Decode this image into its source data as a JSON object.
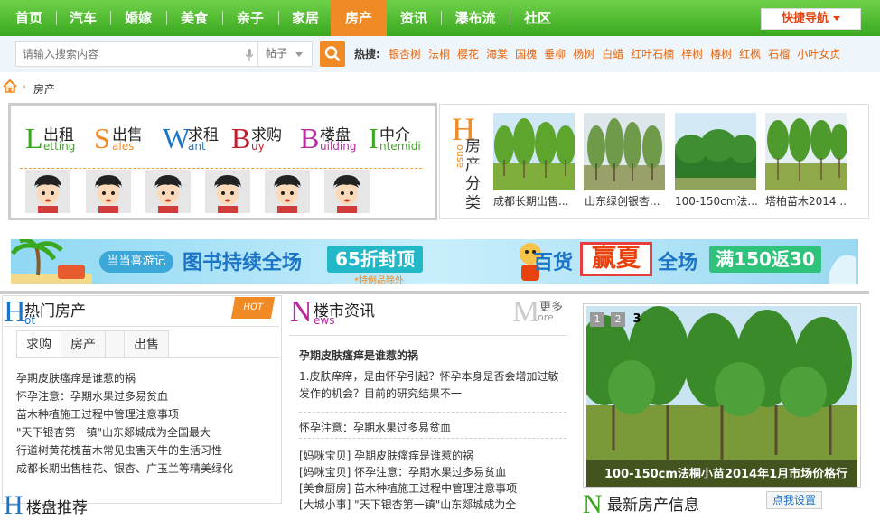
{
  "nav": {
    "items": [
      "首页",
      "汽车",
      "婚嫁",
      "美食",
      "亲子",
      "家居",
      "房产",
      "资讯",
      "瀑布流",
      "社区"
    ],
    "active": "房产",
    "quick": "快捷导航"
  },
  "search": {
    "placeholder": "请输入搜索内容",
    "type": "帖子",
    "hot_label": "热搜:",
    "hotwords": [
      "银杏树",
      "法桐",
      "樱花",
      "海棠",
      "国槐",
      "垂柳",
      "杨树",
      "白蜡",
      "红叶石楠",
      "梓树",
      "椿树",
      "红枫",
      "石榴",
      "小叶女贞"
    ]
  },
  "breadcrumb": {
    "current": "房产"
  },
  "categories": [
    {
      "letter": "L",
      "cn": "出租",
      "en": "etting",
      "color": "#3aa81f"
    },
    {
      "letter": "S",
      "cn": "出售",
      "en": "ales",
      "color": "#f08a24"
    },
    {
      "letter": "W",
      "cn": "求租",
      "en": "ant",
      "color": "#1c74c6"
    },
    {
      "letter": "B",
      "cn": "求购",
      "en": "uy",
      "color": "#c21d2f"
    },
    {
      "letter": "B",
      "cn": "楼盘",
      "en": "uilding",
      "color": "#b62c9e"
    },
    {
      "letter": "I",
      "cn": "中介",
      "en": "ntemidi",
      "color": "#3aa81f"
    }
  ],
  "share": {
    "letter": "H",
    "en": "ouse",
    "cn": "房产分类",
    "items": [
      "成都长期出售...",
      "山东绿创银杏...",
      "100-150cm法...",
      "塔柏苗木2014..."
    ]
  },
  "banner": {
    "promo": "当当喜游记",
    "t1": "图书持续全场",
    "t2": "65折封顶",
    "t3": "*特例品除外",
    "t4": "百货",
    "t5": "赢夏",
    "t6": "全场",
    "t7": "满150返30"
  },
  "hot": {
    "letter": "H",
    "cn": "热门房产",
    "en": "ot",
    "tag": "HOT",
    "tabs": [
      "求购",
      "房产",
      "",
      "出售"
    ],
    "active_tab": "求购",
    "links": [
      "孕期皮肤瘙痒是谁惹的祸",
      "怀孕注意：孕期水果过多易贫血",
      "苗木种植施工过程中管理注意事项",
      "\"天下银杏第一镇\"山东郯城成为全国最大",
      "行道树黄花槐苗木常见虫害天牛的生活习性",
      "成都长期出售桂花、银杏、广玉兰等精美绿化"
    ]
  },
  "news": {
    "letter": "N",
    "cn": "楼市资讯",
    "en": "ews",
    "more_letter": "M",
    "more_cn": "更多",
    "more_en": "ore",
    "headline": "孕期皮肤瘙痒是谁惹的祸",
    "desc": "1.皮肤痒痒，是由怀孕引起？怀孕本身是否会增加过敏发作的机会？目前的研究结果不一",
    "sub": "怀孕注意：孕期水果过多易贫血",
    "items": [
      "[妈咪宝贝] 孕期皮肤瘙痒是谁惹的祸",
      "[妈咪宝贝] 怀孕注意：孕期水果过多易贫血",
      "[美食厨房] 苗木种植施工过程中管理注意事项",
      "[大城小事] \"天下银杏第一镇\"山东郯城成为全"
    ]
  },
  "slide": {
    "nums": [
      "1",
      "2",
      "3"
    ],
    "active": "3",
    "caption": "100-150cm法桐小苗2014年1月市场价格行"
  },
  "latest": {
    "letter": "N",
    "cn": "最新房产信息",
    "setting": "点我设置"
  },
  "brand": {
    "letter": "H",
    "cn": "楼盘推荐"
  }
}
